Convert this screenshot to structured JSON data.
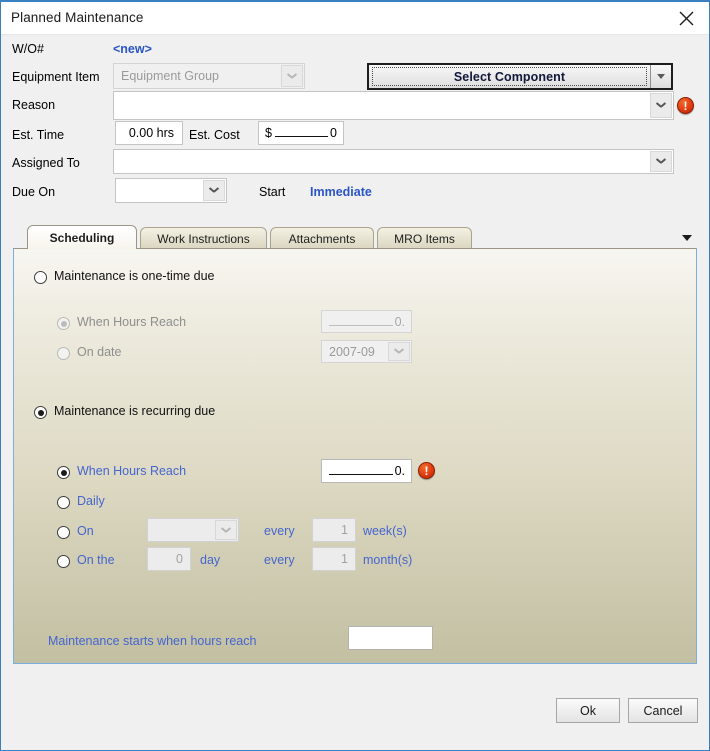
{
  "window": {
    "title": "Planned Maintenance",
    "close_icon": "close-icon"
  },
  "form": {
    "wo_label": "W/O#",
    "wo_value": "<new>",
    "equipment_label": "Equipment Item",
    "equipment_value": "Equipment Group",
    "select_component_label": "Select Component",
    "reason_label": "Reason",
    "reason_value": "",
    "est_time_label": "Est. Time",
    "est_time_value": "0.00 hrs",
    "est_cost_label": "Est. Cost",
    "est_cost_lead": "$",
    "est_cost_tail": "0",
    "assigned_to_label": "Assigned To",
    "assigned_to_value": "",
    "due_on_label": "Due On",
    "due_on_value": "",
    "start_label": "Start",
    "start_value": "Immediate"
  },
  "tabs": [
    {
      "label": "Scheduling",
      "active": true
    },
    {
      "label": "Work Instructions",
      "active": false
    },
    {
      "label": "Attachments",
      "active": false
    },
    {
      "label": "MRO Items",
      "active": false
    }
  ],
  "scheduling": {
    "one_time": {
      "label": "Maintenance is one-time due",
      "selected": false,
      "when_hours_label": "When Hours Reach",
      "when_hours_selected": true,
      "when_hours_value_tail": "0.",
      "on_date_label": "On date",
      "on_date_selected": false,
      "on_date_value": "2007-09"
    },
    "recurring": {
      "label": "Maintenance is recurring due",
      "selected": true,
      "when_hours_label": "When Hours Reach",
      "when_hours_selected": true,
      "when_hours_value_tail": "0.",
      "daily_label": "Daily",
      "daily_selected": false,
      "on_label": "On",
      "on_selected": false,
      "on_day_value": "",
      "on_every_label": "every",
      "on_every_value": "1",
      "on_unit_label": "week(s)",
      "onthe_label": "On the",
      "onthe_selected": false,
      "onthe_day_value": "0",
      "onthe_day_label": "day",
      "onthe_every_label": "every",
      "onthe_every_value": "1",
      "onthe_unit_label": "month(s)"
    },
    "starts_label": "Maintenance starts when hours reach",
    "starts_value": ""
  },
  "footer": {
    "ok_label": "Ok",
    "cancel_label": "Cancel"
  },
  "colors": {
    "accent_blue": "#2b55c7",
    "link_blue": "#4565cf",
    "error_red": "#e23c10",
    "panel_top": "#f7f6f1",
    "panel_bottom": "#c2bfa2",
    "window_border": "#3a7fc1"
  }
}
